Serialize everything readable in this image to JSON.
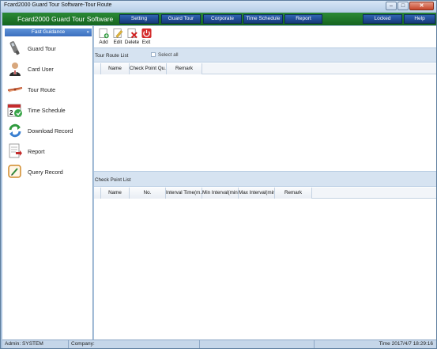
{
  "window": {
    "title": "Fcard2000 Guard Tour Software-Tour Route",
    "minimize_glyph": "–",
    "maximize_glyph": "□",
    "close_glyph": "✕"
  },
  "header": {
    "app_name": "Fcard2000 Guard Tour Software",
    "nav": [
      "Setting",
      "Guard Tour",
      "Corporate",
      "Time Schedule",
      "Report"
    ],
    "locked_label": "Locked",
    "help_label": "Help"
  },
  "sidebar": {
    "heading": "Fast Guidance",
    "collapse_glyph": "«",
    "items": [
      {
        "label": "Guard Tour",
        "icon": "guard-tour-device-icon"
      },
      {
        "label": "Card User",
        "icon": "card-user-icon"
      },
      {
        "label": "Tour Route",
        "icon": "tour-route-icon"
      },
      {
        "label": "Time Schedule",
        "icon": "calendar-icon"
      },
      {
        "label": "Download Record",
        "icon": "download-record-icon"
      },
      {
        "label": "Report",
        "icon": "report-icon"
      },
      {
        "label": "Query Record",
        "icon": "query-record-icon"
      }
    ]
  },
  "toolbar": {
    "add_label": "Add",
    "edit_label": "Edit",
    "delete_label": "Delete",
    "exit_label": "Exit"
  },
  "tour_route_list": {
    "title": "Tour Route List",
    "select_all_label": "Select all",
    "columns": [
      "Name",
      "Check Point Qu...",
      "Remark"
    ]
  },
  "check_point_list": {
    "title": "Check Point List",
    "columns": [
      "Name",
      "No.",
      "Interval Time(m...",
      "Min Interval(min)",
      "Max Interval(min)",
      "Remark"
    ]
  },
  "status": {
    "admin": "Admin: SYSTEM",
    "company": "Company:",
    "time": "Time 2017/4/7 18:29:16"
  },
  "colors": {
    "app_header": "#1f7a2c",
    "nav_button": "#2452a0",
    "close_button": "#c6462b",
    "section_bar": "#d6e3f1"
  }
}
